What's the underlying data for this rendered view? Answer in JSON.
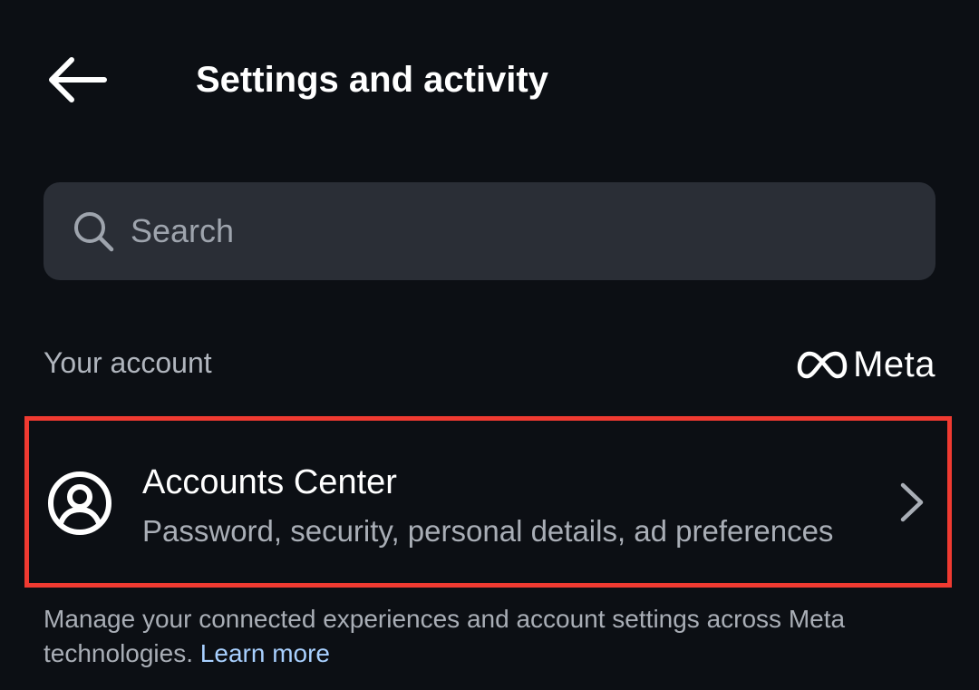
{
  "header": {
    "title": "Settings and activity",
    "back_icon": "arrow-left-icon"
  },
  "search": {
    "placeholder": "Search",
    "value": "",
    "icon": "search-icon"
  },
  "section": {
    "label": "Your account",
    "brand_logo": "meta-logo",
    "brand_text": "Meta"
  },
  "accounts_center": {
    "title": "Accounts Center",
    "subtitle": "Password, security, personal details, ad preferences",
    "icon": "user-circle-icon",
    "chevron": "chevron-right-icon",
    "highlight_color": "#f03a31"
  },
  "footnote": {
    "text": "Manage your connected experiences and account settings across Meta technologies.",
    "link": "Learn more",
    "link_color": "#a8d0ff"
  },
  "colors": {
    "background": "#0c0f14",
    "search_background": "#2a2e36",
    "primary_text": "#ffffff",
    "secondary_text": "#a9aeb6"
  }
}
